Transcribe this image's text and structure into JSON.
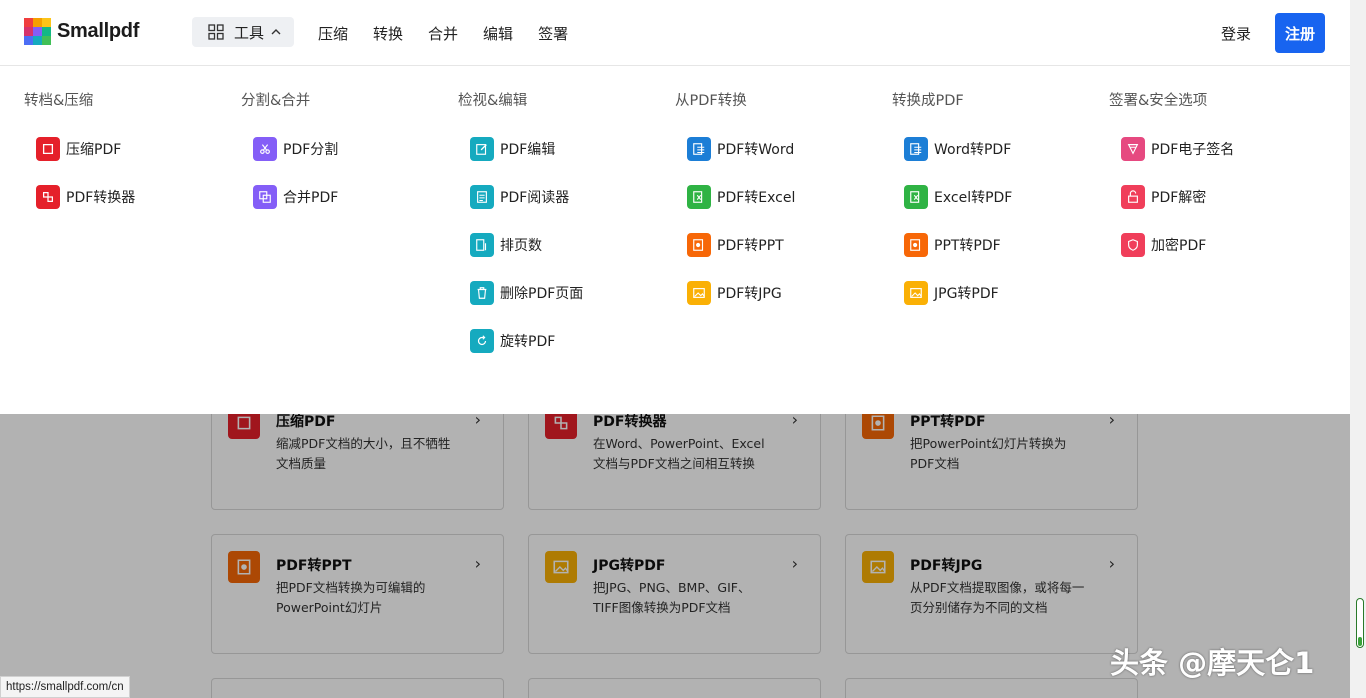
{
  "brand": {
    "name": "Smallpdf",
    "logo_colors": [
      "#f03e3e",
      "#f59f00",
      "#fcc419",
      "#d6336c",
      "#845ef7",
      "#12b886",
      "#4c6ef5",
      "#15aabf",
      "#40c057"
    ]
  },
  "header": {
    "tools_label": "工具",
    "nav": [
      "压缩",
      "转换",
      "合并",
      "编辑",
      "签署"
    ],
    "login_label": "登录",
    "signup_label": "注册",
    "accent": "#1864f0"
  },
  "menu": {
    "columns": [
      {
        "title": "转档&压缩",
        "items": [
          {
            "label": "压缩PDF",
            "color": "#e5202a",
            "icon": "compress-icon"
          },
          {
            "label": "PDF转换器",
            "color": "#e5202a",
            "icon": "convert-icon"
          }
        ]
      },
      {
        "title": "分割&合并",
        "items": [
          {
            "label": "PDF分割",
            "color": "#845ef7",
            "icon": "scissors-icon"
          },
          {
            "label": "合并PDF",
            "color": "#845ef7",
            "icon": "merge-icon"
          }
        ]
      },
      {
        "title": "检视&编辑",
        "items": [
          {
            "label": "PDF编辑",
            "color": "#15aabf",
            "icon": "edit-icon"
          },
          {
            "label": "PDF阅读器",
            "color": "#15aabf",
            "icon": "reader-icon"
          },
          {
            "label": "排页数",
            "color": "#15aabf",
            "icon": "page-number-icon"
          },
          {
            "label": "删除PDF页面",
            "color": "#15aabf",
            "icon": "trash-icon"
          },
          {
            "label": "旋转PDF",
            "color": "#15aabf",
            "icon": "rotate-icon"
          }
        ]
      },
      {
        "title": "从PDF转换",
        "items": [
          {
            "label": "PDF转Word",
            "color": "#1c7ed6",
            "icon": "word-icon"
          },
          {
            "label": "PDF转Excel",
            "color": "#2fb344",
            "icon": "excel-icon"
          },
          {
            "label": "PDF转PPT",
            "color": "#f76707",
            "icon": "ppt-icon"
          },
          {
            "label": "PDF转JPG",
            "color": "#fab005",
            "icon": "jpg-icon"
          }
        ]
      },
      {
        "title": "转换成PDF",
        "items": [
          {
            "label": "Word转PDF",
            "color": "#1c7ed6",
            "icon": "word-icon"
          },
          {
            "label": "Excel转PDF",
            "color": "#2fb344",
            "icon": "excel-icon"
          },
          {
            "label": "PPT转PDF",
            "color": "#f76707",
            "icon": "ppt-icon"
          },
          {
            "label": "JPG转PDF",
            "color": "#fab005",
            "icon": "jpg-icon"
          }
        ]
      },
      {
        "title": "签署&安全选项",
        "items": [
          {
            "label": "PDF电子签名",
            "color": "#e64980",
            "icon": "sign-icon"
          },
          {
            "label": "PDF解密",
            "color": "#f03e5a",
            "icon": "unlock-icon"
          },
          {
            "label": "加密PDF",
            "color": "#f03e5a",
            "icon": "shield-icon"
          }
        ]
      }
    ]
  },
  "cards": [
    {
      "title": "压缩PDF",
      "desc": "缩减PDF文档的大小，且不牺牲文档质量",
      "color": "#e5202a",
      "icon": "compress-icon"
    },
    {
      "title": "PDF转换器",
      "desc": "在Word、PowerPoint、Excel文档与PDF文档之间相互转换",
      "color": "#e5202a",
      "icon": "convert-icon"
    },
    {
      "title": "PPT转PDF",
      "desc": "把PowerPoint幻灯片转换为PDF文档",
      "color": "#f76707",
      "icon": "ppt-icon"
    },
    {
      "title": "PDF转PPT",
      "desc": "把PDF文档转换为可编辑的PowerPoint幻灯片",
      "color": "#f76707",
      "icon": "ppt-icon"
    },
    {
      "title": "JPG转PDF",
      "desc": "把JPG、PNG、BMP、GIF、TIFF图像转换为PDF文档",
      "color": "#fab005",
      "icon": "jpg-icon"
    },
    {
      "title": "PDF转JPG",
      "desc": "从PDF文档提取图像，或将每一页分别储存为不同的文档",
      "color": "#fab005",
      "icon": "jpg-icon"
    }
  ],
  "status_url": "https://smallpdf.com/cn",
  "watermark": "头条 @摩天仑1"
}
